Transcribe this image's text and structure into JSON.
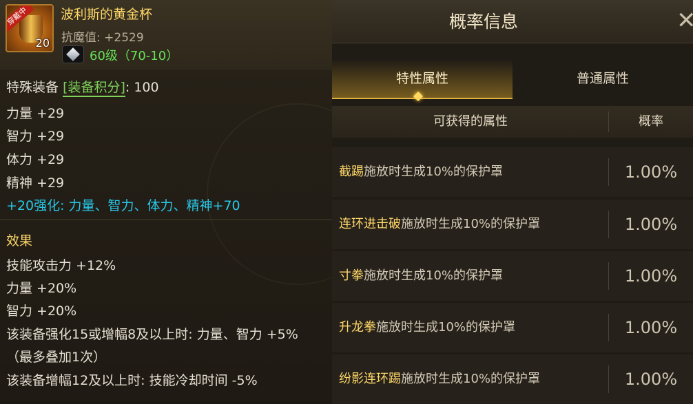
{
  "item": {
    "name": "波利斯的黄金杯",
    "wearing_badge": "穿戴中",
    "icon_level": "20",
    "magic_resistance": "抗魔值: +2529",
    "level_range": "60级（70-10）",
    "score_label": "特殊装备",
    "score_tag": "[装备积分]",
    "score_value": ": 100",
    "stats": [
      "力量 +29",
      "智力 +29",
      "体力 +29",
      "精神 +29"
    ],
    "enhance": "+20强化: 力量、智力、体力、精神+70",
    "effect_title": "效果",
    "effects": [
      "技能攻击力 +12%",
      "力量 +20%",
      "智力 +20%",
      "该装备强化15或增幅8及以上时: 力量、智力 +5%",
      "（最多叠加1次）",
      "该装备增幅12及以上时: 技能冷却时间 -5%"
    ]
  },
  "dialog": {
    "title": "概率信息",
    "close": "✕",
    "tabs": [
      "特性属性",
      "普通属性"
    ],
    "active_tab": 0,
    "columns": [
      "可获得的属性",
      "概率"
    ],
    "rows": [
      {
        "skill": "截踢",
        "desc": "施放时生成10%的保护罩",
        "prob": "1.00%"
      },
      {
        "skill": "连环进击破",
        "desc": "施放时生成10%的保护罩",
        "prob": "1.00%"
      },
      {
        "skill": "寸拳",
        "desc": "施放时生成10%的保护罩",
        "prob": "1.00%"
      },
      {
        "skill": "升龙拳",
        "desc": "施放时生成10%的保护罩",
        "prob": "1.00%"
      },
      {
        "skill": "纷影连环踢",
        "desc": "施放时生成10%的保护罩",
        "prob": "1.00%"
      }
    ]
  },
  "colors": {
    "gold_text": "#ffd86a",
    "green_text": "#66e05a",
    "cyan_text": "#27c8e8"
  }
}
